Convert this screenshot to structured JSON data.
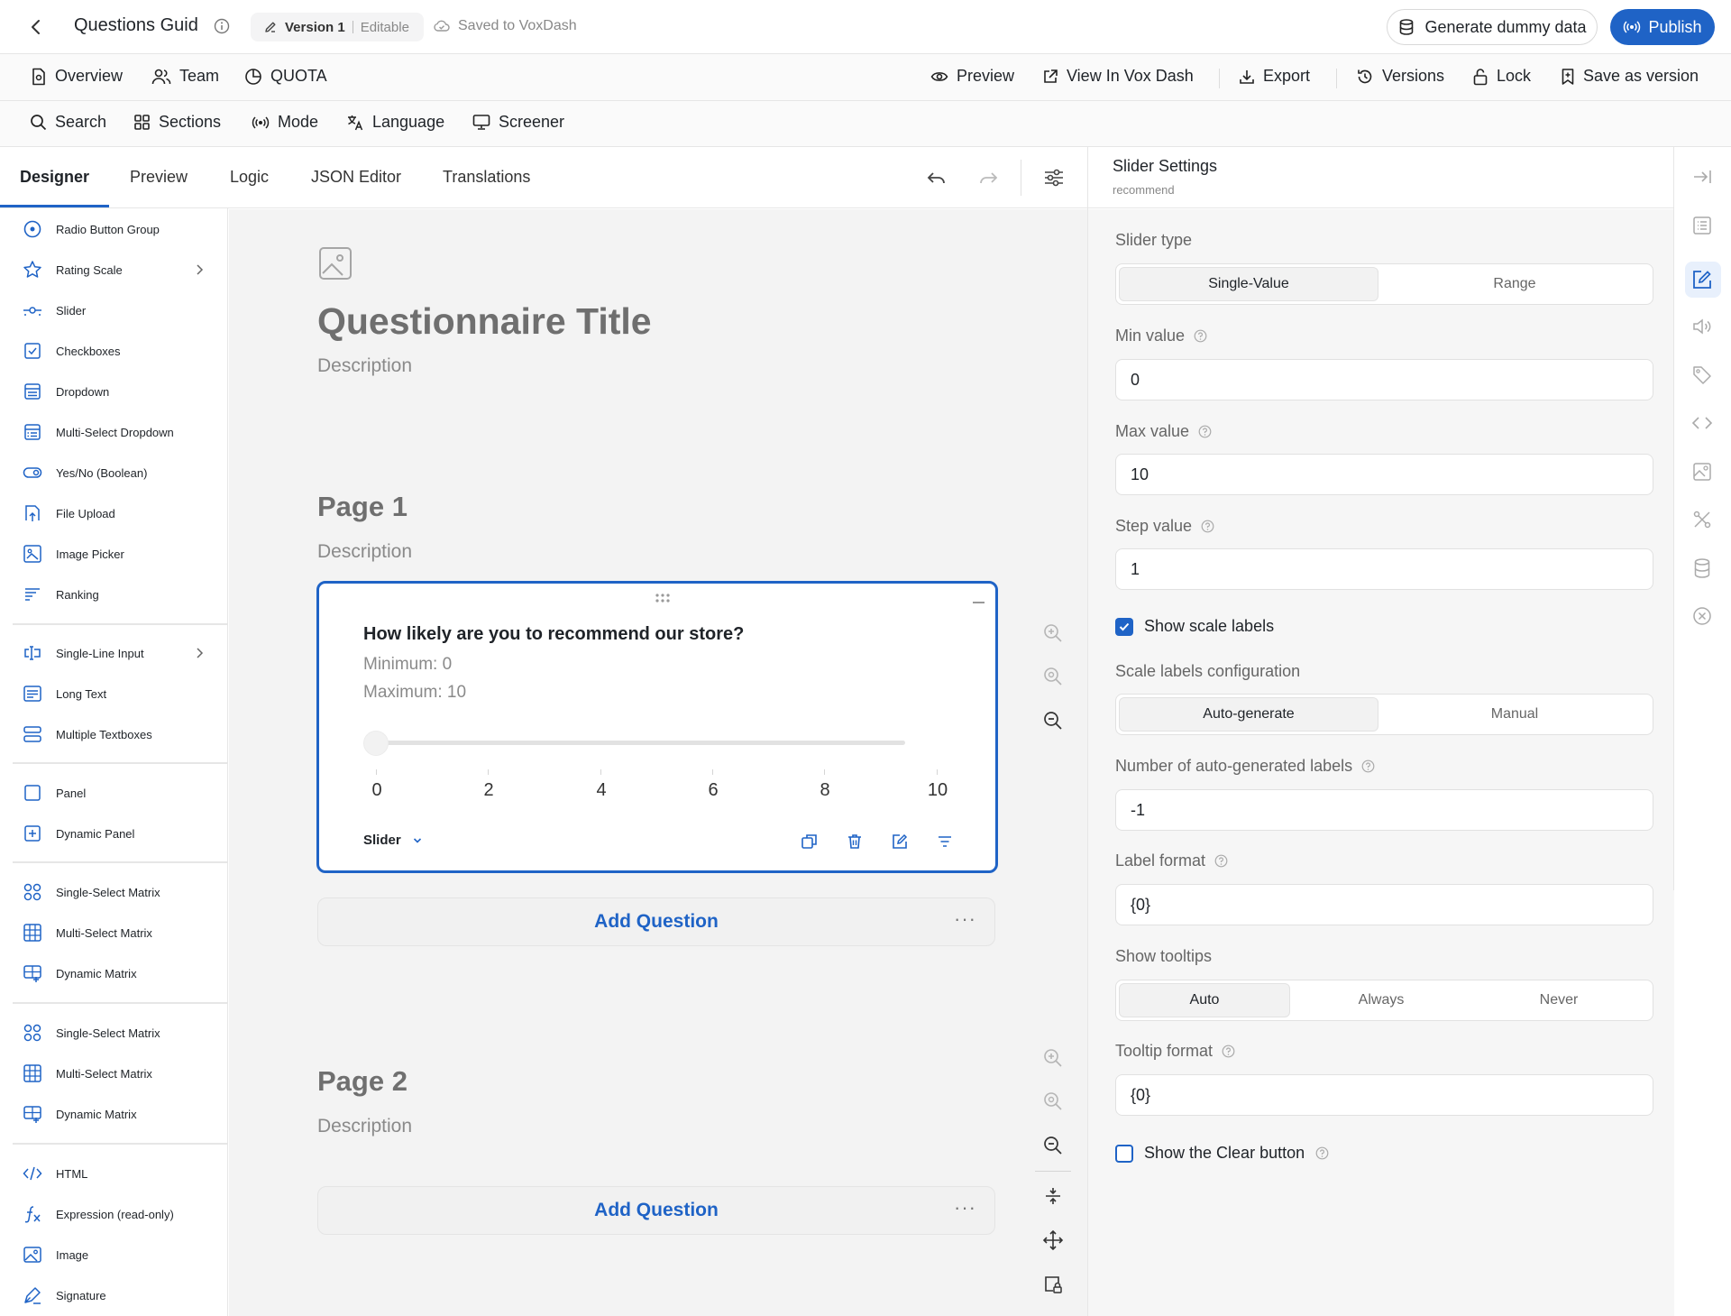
{
  "topbar": {
    "title": "Questions Guid",
    "version": "Version 1",
    "version_state": "Editable",
    "saved_status": "Saved to VoxDash",
    "generate_label": "Generate dummy data",
    "publish_label": "Publish"
  },
  "nav": {
    "overview": "Overview",
    "team": "Team",
    "quota": "QUOTA",
    "preview": "Preview",
    "view_in_vox_dash": "View In Vox Dash",
    "export": "Export",
    "versions": "Versions",
    "lock": "Lock",
    "save_as_version": "Save as version"
  },
  "tools": {
    "search": "Search",
    "sections": "Sections",
    "mode": "Mode",
    "language": "Language",
    "screener": "Screener"
  },
  "tabs": [
    "Designer",
    "Preview",
    "Logic",
    "JSON Editor",
    "Translations"
  ],
  "toolbox": [
    "Radio Button Group",
    "Rating Scale",
    "Slider",
    "Checkboxes",
    "Dropdown",
    "Multi-Select Dropdown",
    "Yes/No (Boolean)",
    "File Upload",
    "Image Picker",
    "Ranking",
    "Single-Line Input",
    "Long Text",
    "Multiple Textboxes",
    "Panel",
    "Dynamic Panel",
    "Single-Select Matrix",
    "Multi-Select Matrix",
    "Dynamic Matrix",
    "Single-Select Matrix",
    "Multi-Select Matrix",
    "Dynamic Matrix",
    "HTML",
    "Expression (read-only)",
    "Image",
    "Signature"
  ],
  "survey": {
    "title": "Questionnaire Title",
    "description": "Description",
    "pages": [
      {
        "title": "Page 1",
        "description": "Description"
      },
      {
        "title": "Page 2",
        "description": "Description"
      }
    ],
    "question": {
      "text": "How likely are you to recommend our store?",
      "minimum": "Minimum: 0",
      "maximum": "Maximum: 10",
      "type": "Slider",
      "value": 0,
      "scale_labels": [
        "0",
        "2",
        "4",
        "6",
        "8",
        "10"
      ]
    },
    "add_question": "Add Question",
    "more": "···"
  },
  "settings": {
    "title": "Slider Settings",
    "subtitle": "recommend",
    "slider_type_label": "Slider type",
    "slider_type_options": [
      "Single-Value",
      "Range"
    ],
    "min_label": "Min value",
    "min_value": "0",
    "max_label": "Max value",
    "max_value": "10",
    "step_label": "Step value",
    "step_value": "1",
    "show_scale_labels": "Show scale labels",
    "scale_config_label": "Scale labels configuration",
    "scale_config_options": [
      "Auto-generate",
      "Manual"
    ],
    "num_labels_label": "Number of auto-generated labels",
    "num_labels_value": "-1",
    "label_format_label": "Label format",
    "label_format_value": "{0}",
    "tooltips_label": "Show tooltips",
    "tooltips_options": [
      "Auto",
      "Always",
      "Never"
    ],
    "tooltip_format_label": "Tooltip format",
    "tooltip_format_value": "{0}",
    "show_clear": "Show the Clear button"
  },
  "colors": {
    "accent": "#1f63c6"
  }
}
